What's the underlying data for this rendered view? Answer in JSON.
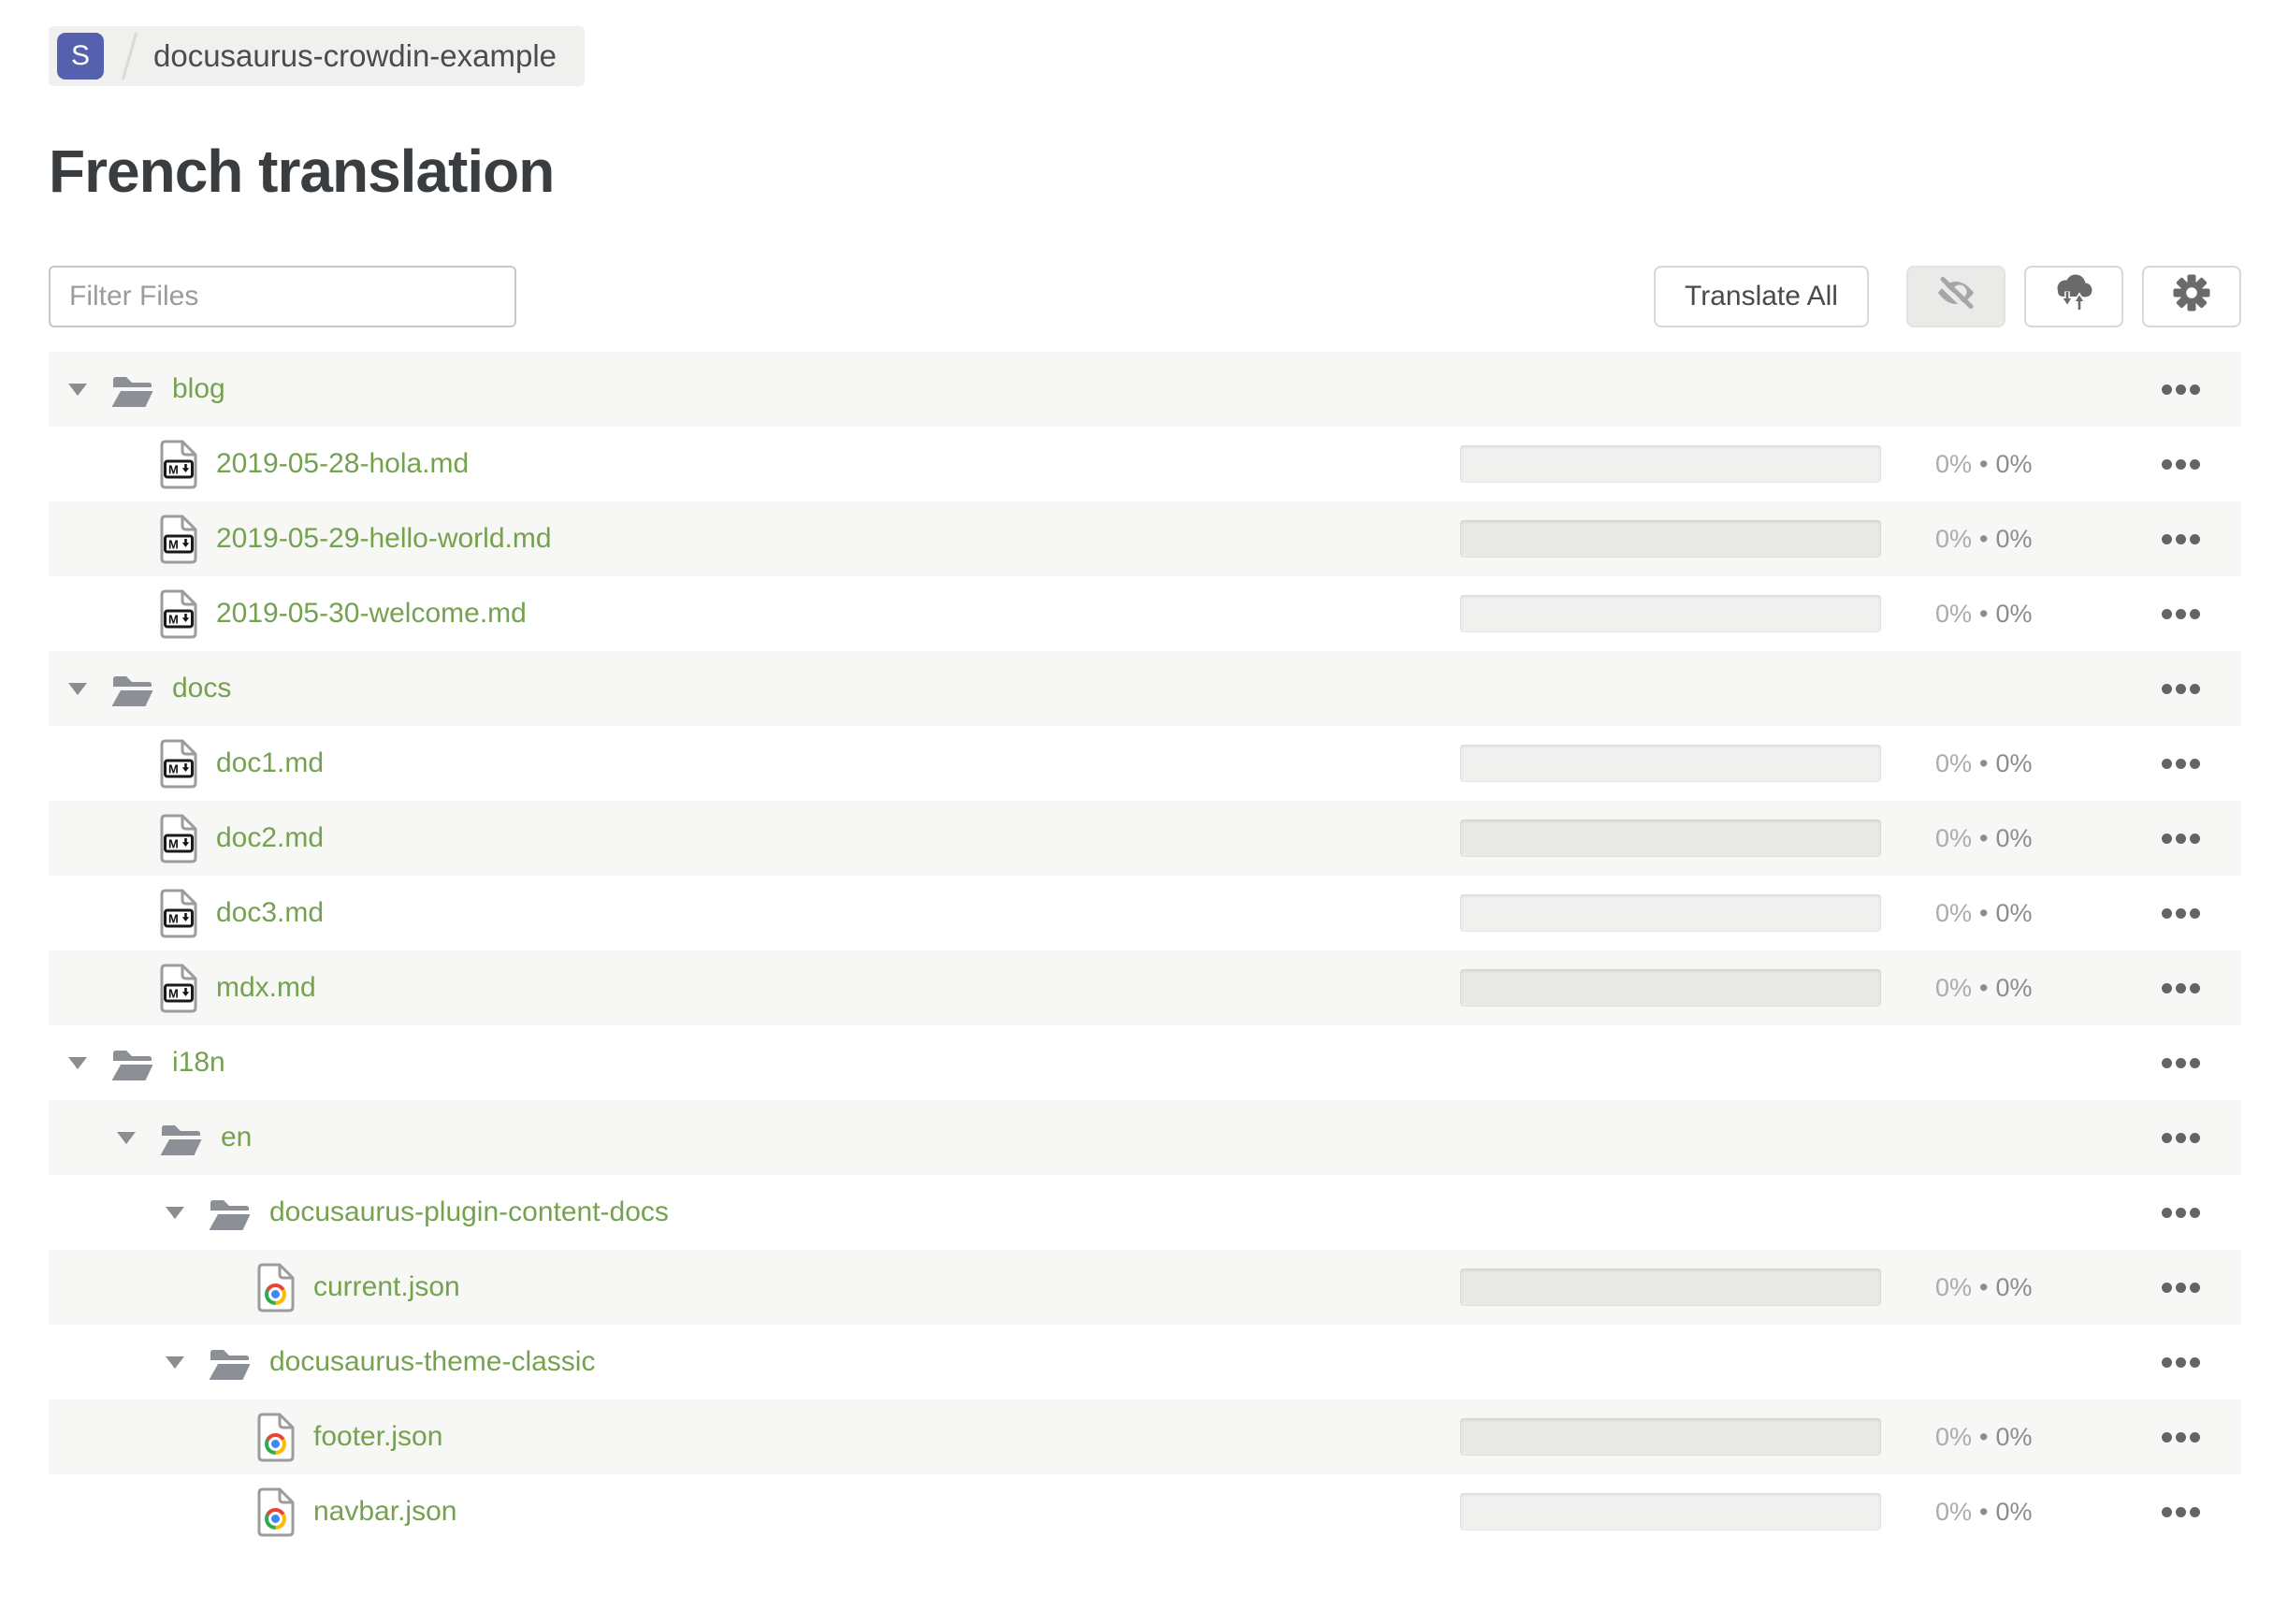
{
  "breadcrumb": {
    "project_initial": "S",
    "project_name": "docusaurus-crowdin-example"
  },
  "page": {
    "title": "French translation"
  },
  "toolbar": {
    "filter_placeholder": "Filter Files",
    "translate_all_label": "Translate All",
    "icon_buttons": [
      "hide-completed-eye-slash",
      "download-upload-cloud",
      "settings-gear"
    ]
  },
  "colors": {
    "link_green": "#74a24f",
    "badge_indigo": "#5561ae",
    "stripe_gray": "#f7f7f5",
    "icon_gray": "#6a6a6a"
  },
  "tree": {
    "percent_separator": "•",
    "rows": [
      {
        "type": "folder",
        "level": 0,
        "name": "blog",
        "state": "expanded"
      },
      {
        "type": "file",
        "level": 1,
        "icon": "markdown-file-icon",
        "name": "2019-05-28-hola.md",
        "translated_percent": "0%",
        "approved_percent": "0%"
      },
      {
        "type": "file",
        "level": 1,
        "icon": "markdown-file-icon",
        "name": "2019-05-29-hello-world.md",
        "translated_percent": "0%",
        "approved_percent": "0%"
      },
      {
        "type": "file",
        "level": 1,
        "icon": "markdown-file-icon",
        "name": "2019-05-30-welcome.md",
        "translated_percent": "0%",
        "approved_percent": "0%"
      },
      {
        "type": "folder",
        "level": 0,
        "name": "docs",
        "state": "expanded"
      },
      {
        "type": "file",
        "level": 1,
        "icon": "markdown-file-icon",
        "name": "doc1.md",
        "translated_percent": "0%",
        "approved_percent": "0%"
      },
      {
        "type": "file",
        "level": 1,
        "icon": "markdown-file-icon",
        "name": "doc2.md",
        "translated_percent": "0%",
        "approved_percent": "0%"
      },
      {
        "type": "file",
        "level": 1,
        "icon": "markdown-file-icon",
        "name": "doc3.md",
        "translated_percent": "0%",
        "approved_percent": "0%"
      },
      {
        "type": "file",
        "level": 1,
        "icon": "markdown-file-icon",
        "name": "mdx.md",
        "translated_percent": "0%",
        "approved_percent": "0%"
      },
      {
        "type": "folder",
        "level": 0,
        "name": "i18n",
        "state": "expanded"
      },
      {
        "type": "folder",
        "level": 1,
        "name": "en",
        "state": "expanded"
      },
      {
        "type": "folder",
        "level": 2,
        "name": "docusaurus-plugin-content-docs",
        "state": "expanded"
      },
      {
        "type": "file",
        "level": 3,
        "icon": "json-file-icon",
        "name": "current.json",
        "translated_percent": "0%",
        "approved_percent": "0%"
      },
      {
        "type": "folder",
        "level": 2,
        "name": "docusaurus-theme-classic",
        "state": "expanded"
      },
      {
        "type": "file",
        "level": 3,
        "icon": "json-file-icon",
        "name": "footer.json",
        "translated_percent": "0%",
        "approved_percent": "0%"
      },
      {
        "type": "file",
        "level": 3,
        "icon": "json-file-icon",
        "name": "navbar.json",
        "translated_percent": "0%",
        "approved_percent": "0%"
      }
    ]
  }
}
